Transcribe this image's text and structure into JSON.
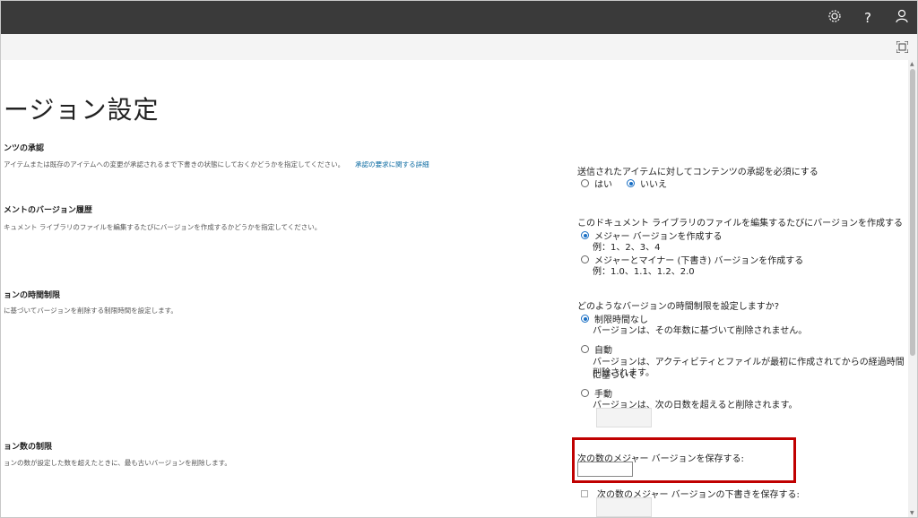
{
  "header": {
    "icons": [
      "gear-icon",
      "help-icon",
      "user-icon"
    ],
    "help_glyph": "?"
  },
  "page": {
    "title": "ージョン設定"
  },
  "sections": {
    "approval": {
      "heading": "ンツの承認",
      "desc": "アイテムまたは既存のアイテムへの変更が承認されるまで下書きの状態にしておくかどうかを指定してください。",
      "link": "承認の要求に関する詳細",
      "question": "送信されたアイテムに対してコンテンツの承認を必須にする",
      "options": [
        "はい",
        "いいえ"
      ]
    },
    "history": {
      "heading": "メントのバージョン履歴",
      "desc": "キュメント ライブラリのファイルを編集するたびにバージョンを作成するかどうかを指定してください。",
      "question": "このドキュメント ライブラリのファイルを編集するたびにバージョンを作成する",
      "opt1": "メジャー バージョンを作成する",
      "opt1_example": "例：1、2、3、4",
      "opt2": "メジャーとマイナー (下書き) バージョンを作成する",
      "opt2_example": "例：1.0、1.1、1.2、2.0"
    },
    "timelimit": {
      "heading": "ョンの時間制限",
      "desc": "に基づいてバージョンを削除する制限時間を設定します。",
      "question": "どのようなバージョンの時間制限を設定しますか?",
      "opt1": "制限時間なし",
      "opt1_desc": "バージョンは、その年数に基づいて削除されません。",
      "opt2": "自動",
      "opt2_desc1": "バージョンは、アクティビティとファイルが最初に作成されてからの経過時間に基づいて",
      "opt2_desc2": "削除されます。",
      "opt3": "手動",
      "opt3_desc": "バージョンは、次の日数を超えると削除されます。"
    },
    "count": {
      "heading": "ョン数の制限",
      "desc": "ョンの数が設定した数を超えたときに、最も古いバージョンを削除します。",
      "major_label": "次の数のメジャー バージョンを保存する:",
      "major_value": "",
      "draft_label": "次の数のメジャー バージョンの下書きを保存する:"
    }
  },
  "colors": {
    "topbar": "#3a3a3a",
    "highlight": "#c00000",
    "link": "#0a6aa1",
    "radio_selected": "#1a6fc4"
  }
}
